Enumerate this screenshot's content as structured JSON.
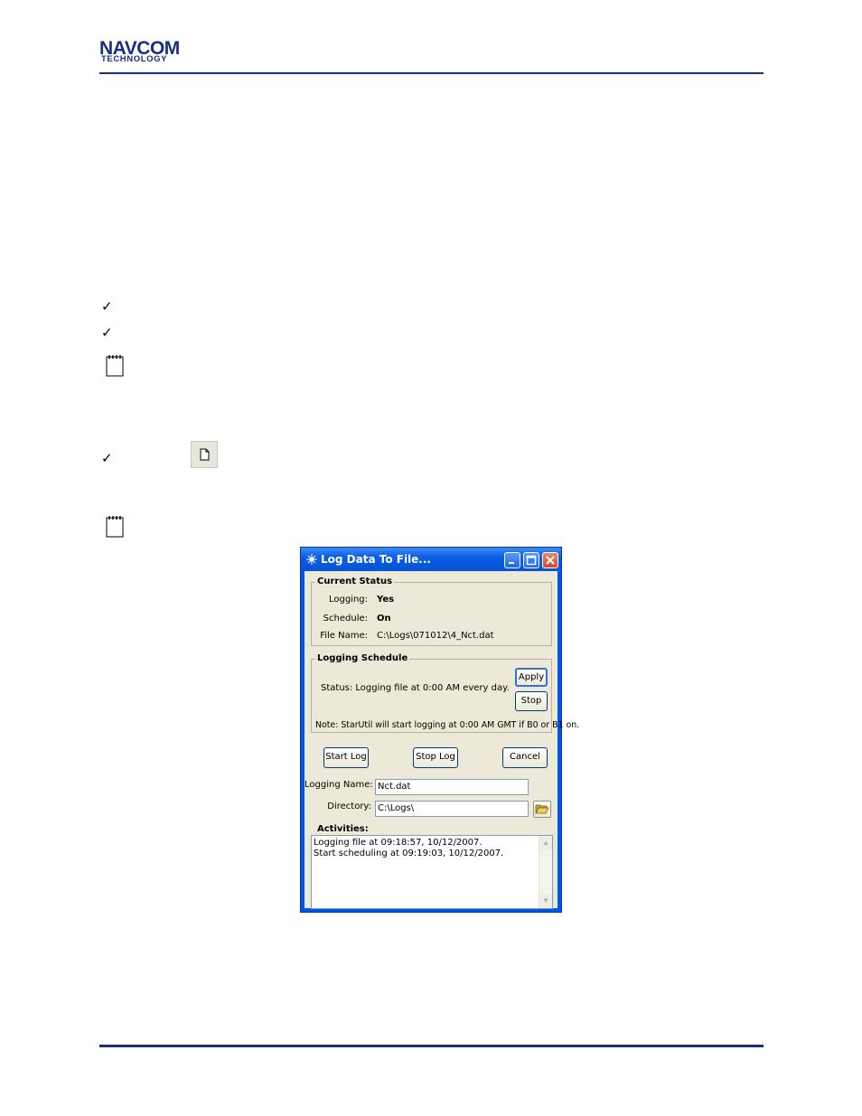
{
  "header": {
    "logo_line1": "NAVCOM",
    "logo_line2": "TECHNOLOGY"
  },
  "icons": {
    "check": "check-mark-icon",
    "note": "notepad-icon",
    "new": "new-file-icon"
  },
  "colors": {
    "brand": "#1a2f7e",
    "title_bar": "#0055ea",
    "dialog_bg": "#ece9d8"
  },
  "dialog": {
    "title": "Log Data To File...",
    "current_status": {
      "group_title": "Current Status",
      "logging_label": "Logging:",
      "logging_value": "Yes",
      "schedule_label": "Schedule:",
      "schedule_value": "On",
      "filename_label": "File Name:",
      "filename_value": "C:\\Logs\\071012\\4_Nct.dat"
    },
    "logging_schedule": {
      "group_title": "Logging Schedule",
      "status_text": "Status:  Logging file at 0:00 AM every day.",
      "apply_label": "Apply",
      "stop_label": "Stop",
      "note_text": "Note: StarUtil will start logging at 0:00 AM GMT if B0 or B1 on."
    },
    "buttons": {
      "start_log": "Start Log",
      "stop_log": "Stop Log",
      "cancel": "Cancel"
    },
    "logging_name_label": "Logging Name:",
    "logging_name_value": "Nct.dat",
    "directory_label": "Directory:",
    "directory_value": "C:\\Logs\\",
    "activities_label": "Activities:",
    "activities": [
      "Logging file at 09:18:57, 10/12/2007.",
      "Start scheduling at 09:19:03, 10/12/2007."
    ]
  }
}
